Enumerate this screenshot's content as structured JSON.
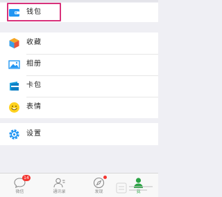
{
  "wallet": {
    "label": "钱包"
  },
  "menu": {
    "items": [
      {
        "label": "收藏"
      },
      {
        "label": "相册"
      },
      {
        "label": "卡包"
      },
      {
        "label": "表情"
      }
    ]
  },
  "settings": {
    "label": "设置"
  },
  "tabbar": {
    "tabs": [
      {
        "label": "微信",
        "badge": "14"
      },
      {
        "label": "通讯录"
      },
      {
        "label": "发现",
        "dot": true
      },
      {
        "label": "我",
        "active": true
      }
    ]
  },
  "colors": {
    "accent_green": "#2aa344",
    "highlight_border": "#d8317a",
    "badge_red": "#f43530",
    "wallet_blue": "#2196f3"
  },
  "icons": {
    "wallet": "wallet-icon",
    "favorites": "favorites-cube-icon",
    "album": "album-picture-icon",
    "card": "card-package-icon",
    "sticker": "sticker-smiley-icon",
    "settings": "settings-gear-icon",
    "chats": "chat-bubble-icon",
    "contacts": "contacts-icon",
    "discover": "compass-icon",
    "me": "person-icon"
  }
}
